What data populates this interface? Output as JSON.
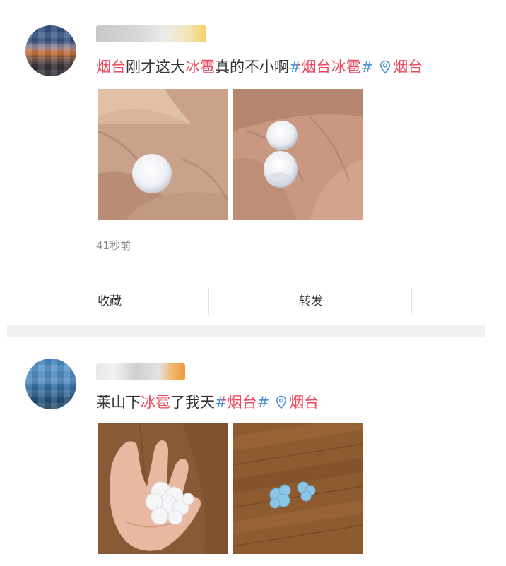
{
  "posts": [
    {
      "content": {
        "loc_prefix": "烟台",
        "t1": "刚才这大",
        "hail_word": "冰雹",
        "t2": "真的不小啊",
        "hashtag": "#烟台冰雹#",
        "location": "烟台"
      },
      "images": [
        "hail-in-fingers-photo",
        "hail-on-palm-photo"
      ],
      "time": "41秒前",
      "actions": {
        "favorite": "收藏",
        "forward": "转发"
      }
    },
    {
      "content": {
        "t1": "莱山下",
        "hail_word": "冰雹",
        "t2": "了我天",
        "hashtag": "#烟台#",
        "location": "烟台"
      },
      "images": [
        "hail-pile-on-hand-photo",
        "hail-on-wood-floor-photo"
      ]
    }
  ],
  "colors": {
    "topic": "#eb4a5e",
    "hashtag_marks": "#4c8fd8",
    "location_icon": "#4c8fd8"
  },
  "icons": [
    "location-pin-icon"
  ]
}
